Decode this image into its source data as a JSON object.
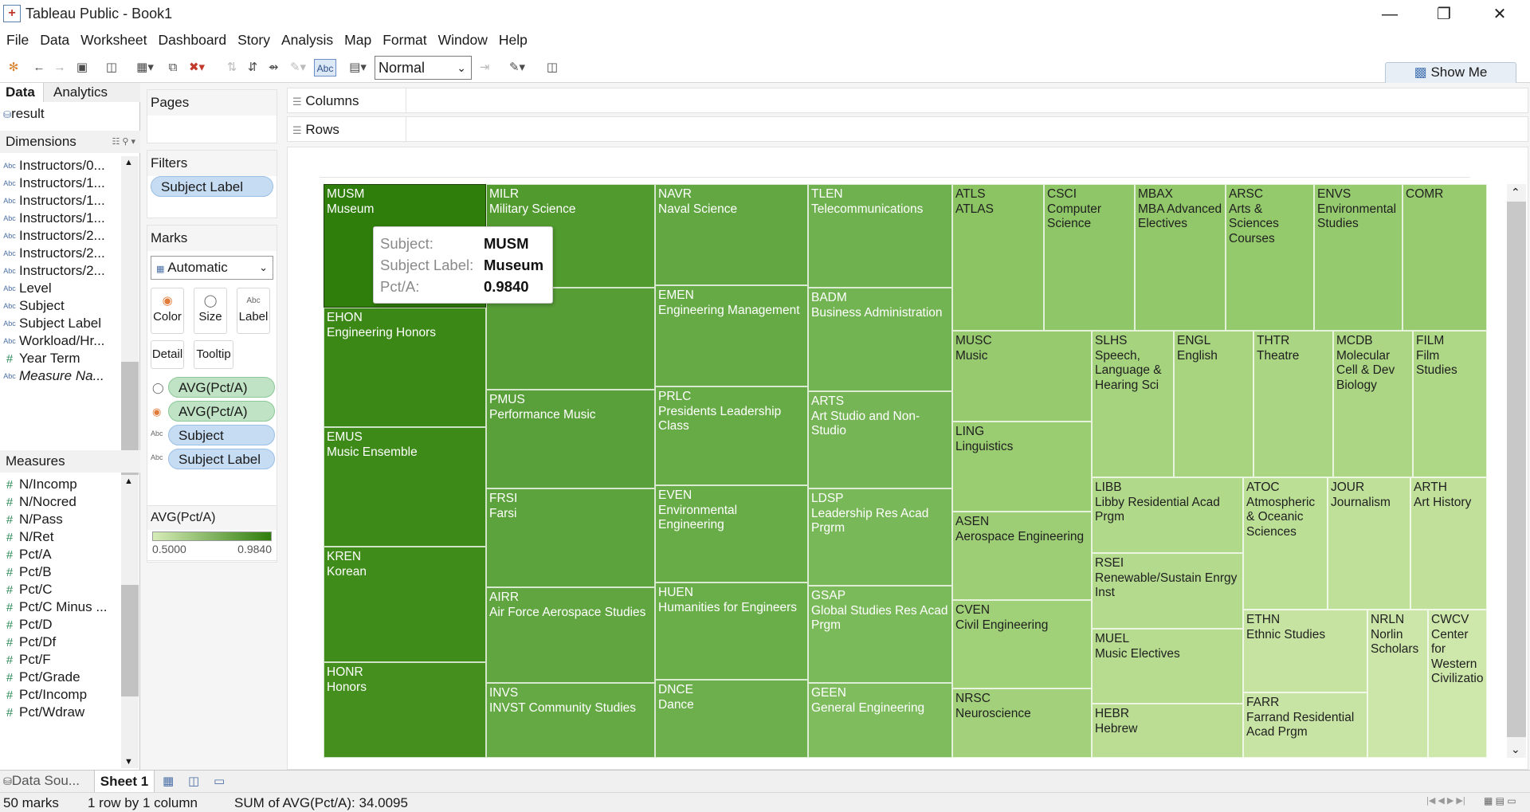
{
  "window": {
    "title": "Tableau Public - Book1",
    "app_icon": "tableau-logo-icon",
    "controls": [
      "minimize-icon",
      "restore-icon",
      "close-icon"
    ]
  },
  "menu": [
    "File",
    "Data",
    "Worksheet",
    "Dashboard",
    "Story",
    "Analysis",
    "Map",
    "Format",
    "Window",
    "Help"
  ],
  "toolbar": {
    "fit": "Normal",
    "abc": "Abc",
    "show_me": "Show Me"
  },
  "data_pane": {
    "tabs": [
      "Data",
      "Analytics"
    ],
    "datasource": "result",
    "dimensions_label": "Dimensions",
    "dimensions": [
      "Instructors/0...",
      "Instructors/1...",
      "Instructors/1...",
      "Instructors/1...",
      "Instructors/2...",
      "Instructors/2...",
      "Instructors/2...",
      "Level",
      "Subject",
      "Subject Label",
      "Workload/Hr...",
      "Year Term",
      "Measure Na..."
    ],
    "measures_label": "Measures",
    "measures": [
      "N/Incomp",
      "N/Nocred",
      "N/Pass",
      "N/Ret",
      "Pct/A",
      "Pct/B",
      "Pct/C",
      "Pct/C Minus ...",
      "Pct/D",
      "Pct/Df",
      "Pct/F",
      "Pct/Grade",
      "Pct/Incomp",
      "Pct/Wdraw"
    ]
  },
  "cards": {
    "pages": "Pages",
    "filters": "Filters",
    "filter_pill": "Subject Label",
    "marks": "Marks",
    "mark_type": "Automatic",
    "mark_buttons": [
      "Color",
      "Size",
      "Label",
      "Detail",
      "Tooltip"
    ],
    "mark_pills": [
      "AVG(Pct/A)",
      "AVG(Pct/A)",
      "Subject",
      "Subject Label"
    ],
    "legend_title": "AVG(Pct/A)",
    "legend_min": "0.5000",
    "legend_max": "0.9840",
    "color_low": "#d7ecb8",
    "color_high": "#2f7d0b"
  },
  "shelves": {
    "columns": "Columns",
    "rows": "Rows"
  },
  "treemap": [
    {
      "code": "MUSM",
      "name": "Museum",
      "color": "#2f7d0b"
    },
    {
      "code": "EHON",
      "name": "Engineering Honors",
      "color": "#3b8816"
    },
    {
      "code": "EMUS",
      "name": "Music Ensemble",
      "color": "#3d8a18"
    },
    {
      "code": "KREN",
      "name": "Korean",
      "color": "#408c1a"
    },
    {
      "code": "HONR",
      "name": "Honors",
      "color": "#448f1e"
    },
    {
      "code": "MILR",
      "name": "Military Science",
      "color": "#519a2e"
    },
    {
      "code": "",
      "name": "Education",
      "color": "#579d36"
    },
    {
      "code": "PMUS",
      "name": "Performance Music",
      "color": "#5aa03a"
    },
    {
      "code": "FRSI",
      "name": "Farsi",
      "color": "#5da33d"
    },
    {
      "code": "AIRR",
      "name": "Air Force Aerospace Studies",
      "color": "#60a540"
    },
    {
      "code": "INVS",
      "name": "INVST Community Studies",
      "color": "#64a944"
    },
    {
      "code": "NAVR",
      "name": "Naval Science",
      "color": "#62a742"
    },
    {
      "code": "EMEN",
      "name": "Engineering Management",
      "color": "#65aa45"
    },
    {
      "code": "PRLC",
      "name": "Presidents Leadership Class",
      "color": "#67ab47"
    },
    {
      "code": "EVEN",
      "name": "Environmental Engineering",
      "color": "#68ac48"
    },
    {
      "code": "HUEN",
      "name": "Humanities for Engineers",
      "color": "#6aae4a"
    },
    {
      "code": "DNCE",
      "name": "Dance",
      "color": "#6caf4c"
    },
    {
      "code": "TLEN",
      "name": "Telecommunications",
      "color": "#6fb14f"
    },
    {
      "code": "BADM",
      "name": "Business Administration",
      "color": "#72b352"
    },
    {
      "code": "ARTS",
      "name": "Art Studio and Non-Studio",
      "color": "#75b555"
    },
    {
      "code": "LDSP",
      "name": "Leadership Res Acad Prgrm",
      "color": "#78b858"
    },
    {
      "code": "GSAP",
      "name": "Global Studies Res Acad Prgm",
      "color": "#7bba5b"
    },
    {
      "code": "GEEN",
      "name": "General Engineering",
      "color": "#7ebc5e"
    },
    {
      "code": "ATLS",
      "name": "ATLAS",
      "color": "#8cc464"
    },
    {
      "code": "CSCI",
      "name": "Computer Science",
      "color": "#8fc667"
    },
    {
      "code": "MBAX",
      "name": "MBA Advanced Electives",
      "color": "#92c86a"
    },
    {
      "code": "ARSC",
      "name": "Arts & Sciences Courses",
      "color": "#94c96c"
    },
    {
      "code": "ENVS",
      "name": "Environmental Studies",
      "color": "#96ca6e"
    },
    {
      "code": "COMR",
      "name": "",
      "color": "#98cb70"
    },
    {
      "code": "MUSC",
      "name": "Music",
      "color": "#97ca6f"
    },
    {
      "code": "LING",
      "name": "Linguistics",
      "color": "#9acc72"
    },
    {
      "code": "ASEN",
      "name": "Aerospace Engineering",
      "color": "#9dce75"
    },
    {
      "code": "CVEN",
      "name": "Civil Engineering",
      "color": "#a0d078"
    },
    {
      "code": "NRSC",
      "name": "Neuroscience",
      "color": "#a3d17b"
    },
    {
      "code": "SLHS",
      "name": "Speech, Language & Hearing Sci",
      "color": "#a6d37e"
    },
    {
      "code": "ENGL",
      "name": "English",
      "color": "#a8d480"
    },
    {
      "code": "THTR",
      "name": "Theatre",
      "color": "#aad582"
    },
    {
      "code": "MCDB",
      "name": "Molecular Cell & Dev Biology",
      "color": "#acd684"
    },
    {
      "code": "FILM",
      "name": "Film Studies",
      "color": "#aed786"
    },
    {
      "code": "LIBB",
      "name": "Libby Residential Acad Prgm",
      "color": "#b1d98a"
    },
    {
      "code": "RSEI",
      "name": "Renewable/Sustain Enrgy Inst",
      "color": "#b4da8d"
    },
    {
      "code": "MUEL",
      "name": "Music Electives",
      "color": "#b7dc90"
    },
    {
      "code": "HEBR",
      "name": "Hebrew",
      "color": "#badd93"
    },
    {
      "code": "ATOC",
      "name": "Atmospheric & Oceanic Sciences",
      "color": "#bcdf96"
    },
    {
      "code": "JOUR",
      "name": "Journalism",
      "color": "#bfe099"
    },
    {
      "code": "ARTH",
      "name": "Art History",
      "color": "#c1e19b"
    },
    {
      "code": "ETHN",
      "name": "Ethnic Studies",
      "color": "#c6e3a2"
    },
    {
      "code": "FARR",
      "name": "Farrand Residential Acad Prgm",
      "color": "#c8e4a4"
    },
    {
      "code": "NRLN",
      "name": "Norlin Scholars",
      "color": "#cbe6a8"
    },
    {
      "code": "CWCV",
      "name": "Center for Western Civilizatio",
      "color": "#cee7ab"
    }
  ],
  "tooltip": {
    "subject_key": "Subject:",
    "subject_val": "MUSM",
    "label_key": "Subject Label:",
    "label_val": "Museum",
    "pct_key": "Pct/A:",
    "pct_val": "0.9840"
  },
  "sheets": {
    "datasource_tab": "Data Sou...",
    "active_sheet": "Sheet 1"
  },
  "status": {
    "marks": "50 marks",
    "dims": "1 row by 1 column",
    "sum": "SUM of AVG(Pct/A): 34.0095"
  }
}
